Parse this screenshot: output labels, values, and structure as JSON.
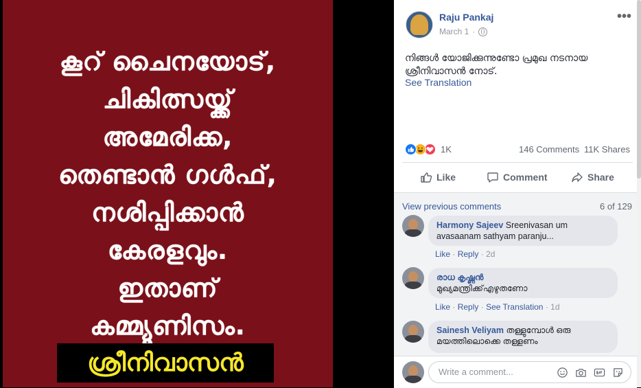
{
  "photo": {
    "lines": [
      "കൂറ് ചൈനയോട്,",
      "ചികിത്സയ്ക്ക്",
      "അമേരിക്ക,",
      "തെണ്ടാൻ ഗൾഫ്,",
      "നശിപ്പിക്കാൻ",
      "കേരളവും.",
      "ഇതാണ്",
      "കമ്മ്യൂണിസം."
    ],
    "highlight": "ശ്രീനിവാസൻ"
  },
  "post": {
    "author": "Raju Pankaj",
    "date": "March 1",
    "separator": "·",
    "more_icon": "•••",
    "text": "നിങ്ങൾ യോജിക്കുന്നുണ്ടോ പ്രമുഖ നടനായ ശ്രീനിവാസൻ നോട്.",
    "see_translation": "See Translation",
    "reaction_count": "1K",
    "comments_count": "146 Comments",
    "shares_count": "11K Shares",
    "reactions": [
      "like-icon",
      "haha-icon",
      "love-icon"
    ]
  },
  "actions": {
    "like": "Like",
    "comment": "Comment",
    "share": "Share"
  },
  "comments_section": {
    "view_previous": "View previous comments",
    "page": "6 of 129",
    "comments": [
      {
        "name": "Harmony Sajeev",
        "text": "Sreenivasan um avasaanam sathyam paranju...",
        "like": "Like",
        "reply": "Reply",
        "time": "2d"
      },
      {
        "name": "രാധ കൃഷ്ണൻ",
        "text": "മുഖ്യമന്ത്രിക്ക്എഴുതണോ",
        "like": "Like",
        "reply": "Reply",
        "see_translation": "See Translation",
        "time": "1d"
      },
      {
        "name": "Sainesh Veliyam",
        "text": "തള്ളുമ്പോൾ ഒരു മയത്തിലൊക്കെ തള്ളണം"
      }
    ]
  },
  "composer": {
    "placeholder": "Write a comment..."
  },
  "colors": {
    "link": "#365899",
    "photo_background": "#7a1019",
    "highlight_text": "#f5e72a"
  }
}
